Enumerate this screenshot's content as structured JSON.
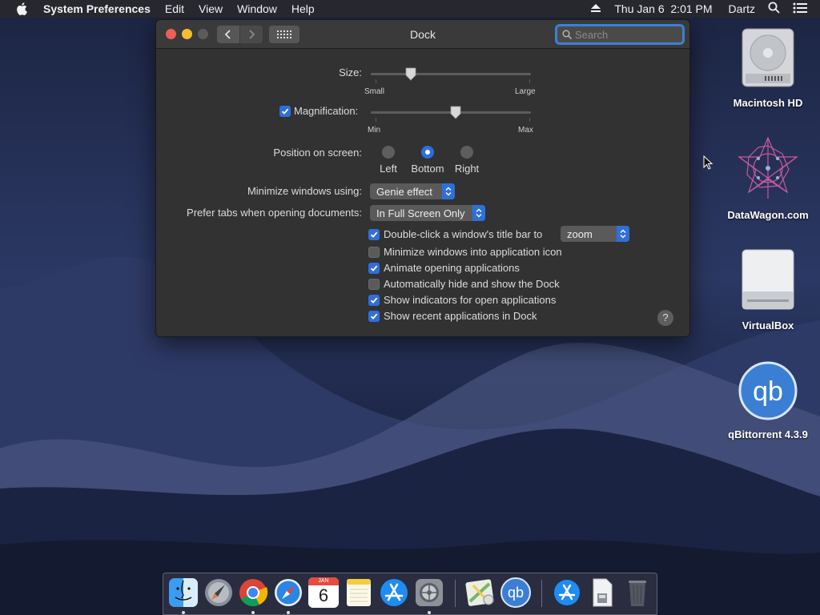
{
  "menubar": {
    "app_name": "System Preferences",
    "menus": [
      "Edit",
      "View",
      "Window",
      "Help"
    ],
    "clock": "Thu Jan 6  2:01 PM",
    "user": "Dartz"
  },
  "window": {
    "title": "Dock",
    "search_placeholder": "Search",
    "size": {
      "label": "Size:",
      "min_label": "Small",
      "max_label": "Large",
      "value": 0.25
    },
    "magnification": {
      "label": "Magnification:",
      "checked": true,
      "min_label": "Min",
      "max_label": "Max",
      "value": 0.53
    },
    "position": {
      "label": "Position on screen:",
      "options": [
        "Left",
        "Bottom",
        "Right"
      ],
      "selected": "Bottom"
    },
    "minimize": {
      "label": "Minimize windows using:",
      "value": "Genie effect"
    },
    "prefer_tabs": {
      "label": "Prefer tabs when opening documents:",
      "value": "In Full Screen Only"
    },
    "double_click": {
      "label": "Double-click a window's title bar to",
      "checked": true,
      "value": "zoom"
    },
    "options": [
      {
        "label": "Minimize windows into application icon",
        "checked": false
      },
      {
        "label": "Animate opening applications",
        "checked": true
      },
      {
        "label": "Automatically hide and show the Dock",
        "checked": false
      },
      {
        "label": "Show indicators for open applications",
        "checked": true
      },
      {
        "label": "Show recent applications in Dock",
        "checked": true
      }
    ],
    "help": "?"
  },
  "desktop_icons": [
    {
      "label": "Macintosh HD",
      "icon": "hard-drive-icon"
    },
    {
      "label": "DataWagon.com",
      "icon": "datawagon-icon"
    },
    {
      "label": "VirtualBox",
      "icon": "external-drive-icon"
    },
    {
      "label": "qBittorrent 4.3.9",
      "icon": "qbittorrent-icon"
    }
  ],
  "dock": {
    "calendar_month": "JAN",
    "calendar_day": "6",
    "qb_text": "qb"
  },
  "colors": {
    "accent": "#2f6fdb",
    "window_bg": "#323232"
  }
}
